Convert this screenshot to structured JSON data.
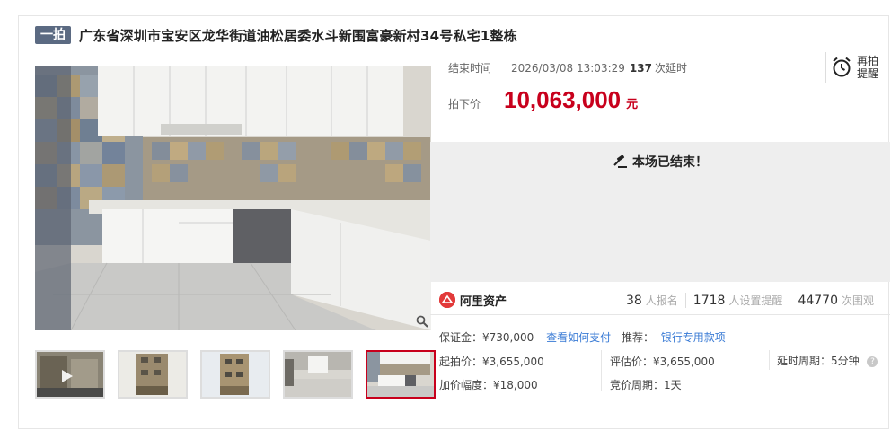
{
  "header": {
    "tag": "一拍",
    "title": "广东省深圳市宝安区龙华街道油松居委水斗新围富豪新村34号私宅1整栋"
  },
  "auction": {
    "end_label": "结束时间",
    "end_time": "2026/03/08 13:03:29",
    "delay_count": "137",
    "delay_suffix": "次延时",
    "remind_label": "再拍提醒",
    "price_label": "拍下价",
    "price": "10,063,000",
    "price_unit": "元",
    "ended_text": "本场已结束！"
  },
  "platform": {
    "brand_name": "阿里资产",
    "stats": [
      {
        "num": "38",
        "txt": "人报名"
      },
      {
        "num": "1718",
        "txt": "人设置提醒"
      },
      {
        "num": "44770",
        "txt": "次围观"
      }
    ]
  },
  "details": {
    "deposit": "保证金：¥730,000",
    "how_to_pay": "查看如何支付",
    "recommend_label": "推荐：",
    "bank_loan": "银行专用款项",
    "start_price": "起拍价：¥3,655,000",
    "appraise_price": "评估价：¥3,655,000",
    "delay_period": "延时周期：5分钟",
    "increment": "加价幅度：¥18,000",
    "bid_period": "竞价周期：1天"
  },
  "gallery": {
    "thumbnails": [
      "building exterior",
      "building exterior",
      "building exterior",
      "interior room",
      "kitchen"
    ],
    "active_index": 4
  },
  "colors": {
    "accent": "#c8001c",
    "link": "#3a7bd5",
    "tag_bg": "#5b6a82"
  }
}
